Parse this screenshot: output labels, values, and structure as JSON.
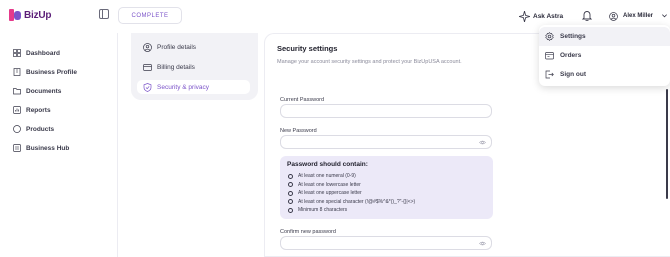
{
  "brand": {
    "name": "BizUp",
    "accent": "#7b53c9",
    "logo_color": "#5b1e78"
  },
  "header": {
    "status_label": "COMPLETE",
    "ask_astra_label": "Ask Astra",
    "user_name": "Alex Miller"
  },
  "user_menu": {
    "items": [
      {
        "label": "Settings",
        "icon": "gear-icon"
      },
      {
        "label": "Orders",
        "icon": "orders-icon"
      },
      {
        "label": "Sign out",
        "icon": "sign-out-icon"
      }
    ]
  },
  "sidebar": {
    "items": [
      {
        "label": "Dashboard",
        "icon": "grid-icon"
      },
      {
        "label": "Business Profile",
        "icon": "building-icon"
      },
      {
        "label": "Documents",
        "icon": "folder-icon"
      },
      {
        "label": "Reports",
        "icon": "report-icon"
      },
      {
        "label": "Products",
        "icon": "box-icon"
      },
      {
        "label": "Business Hub",
        "icon": "hub-icon"
      }
    ]
  },
  "settings_nav": {
    "items": [
      {
        "label": "Profile details",
        "icon": "user-circle-icon"
      },
      {
        "label": "Billing details",
        "icon": "card-icon"
      },
      {
        "label": "Security & privacy",
        "icon": "shield-icon",
        "active": true
      }
    ]
  },
  "security": {
    "title": "Security settings",
    "subtitle": "Manage your account security settings and protect your BizUpUSA account.",
    "current_password_label": "Current Password",
    "new_password_label": "New Password",
    "confirm_password_label": "Confirm new password",
    "rules_title": "Password should contain:",
    "rules": [
      "At least one numeral (0-9)",
      "At least one lowercase letter",
      "At least one uppercase letter",
      "At least one special character (!@#$%^&*()_?\"-{}|<>)",
      "Minimum 8 characters"
    ]
  }
}
